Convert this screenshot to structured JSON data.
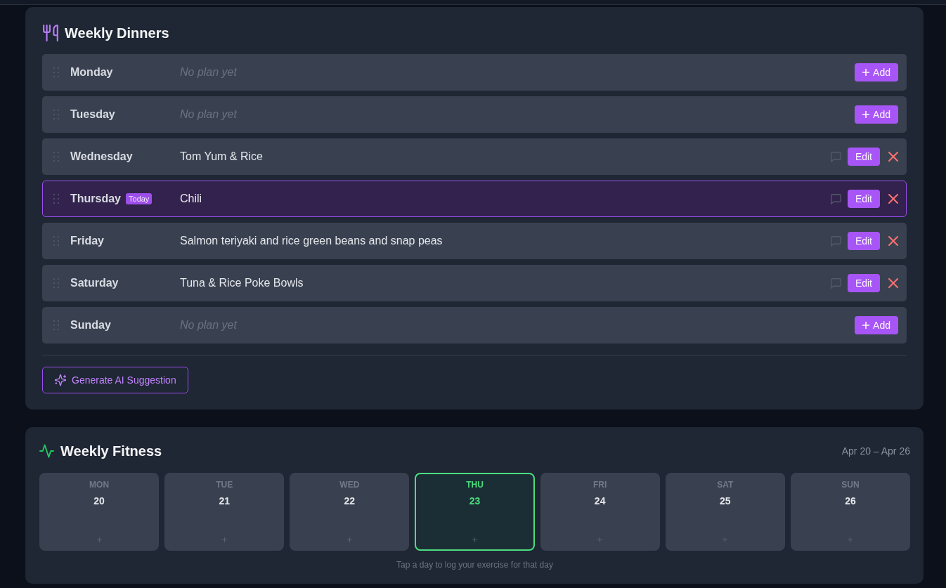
{
  "dinners": {
    "title": "Weekly Dinners",
    "days": [
      {
        "day": "Monday",
        "kind": "empty",
        "today": false,
        "placeholder": "No plan yet",
        "action": "Add"
      },
      {
        "day": "Tuesday",
        "kind": "empty",
        "today": false,
        "placeholder": "No plan yet",
        "action": "Add"
      },
      {
        "day": "Wednesday",
        "kind": "planned",
        "today": false,
        "meal": "Tom Yum & Rice",
        "action": "Edit"
      },
      {
        "day": "Thursday",
        "kind": "planned",
        "today": true,
        "badge": "Today",
        "meal": "Chili",
        "action": "Edit"
      },
      {
        "day": "Friday",
        "kind": "planned",
        "today": false,
        "meal": "Salmon teriyaki and rice green beans and snap peas",
        "action": "Edit"
      },
      {
        "day": "Saturday",
        "kind": "planned",
        "today": false,
        "meal": "Tuna & Rice Poke Bowls",
        "action": "Edit"
      },
      {
        "day": "Sunday",
        "kind": "empty",
        "today": false,
        "placeholder": "No plan yet",
        "action": "Add"
      }
    ],
    "suggest_button": "Generate AI Suggestion"
  },
  "fitness": {
    "title": "Weekly Fitness",
    "date_range": "Apr 20 – Apr 26",
    "days": [
      {
        "label": "MON",
        "date": "20",
        "today": false
      },
      {
        "label": "TUE",
        "date": "21",
        "today": false
      },
      {
        "label": "WED",
        "date": "22",
        "today": false
      },
      {
        "label": "THU",
        "date": "23",
        "today": true
      },
      {
        "label": "FRI",
        "date": "24",
        "today": false
      },
      {
        "label": "SAT",
        "date": "25",
        "today": false
      },
      {
        "label": "SUN",
        "date": "26",
        "today": false
      }
    ],
    "hint": "Tap a day to log your exercise for that day"
  }
}
